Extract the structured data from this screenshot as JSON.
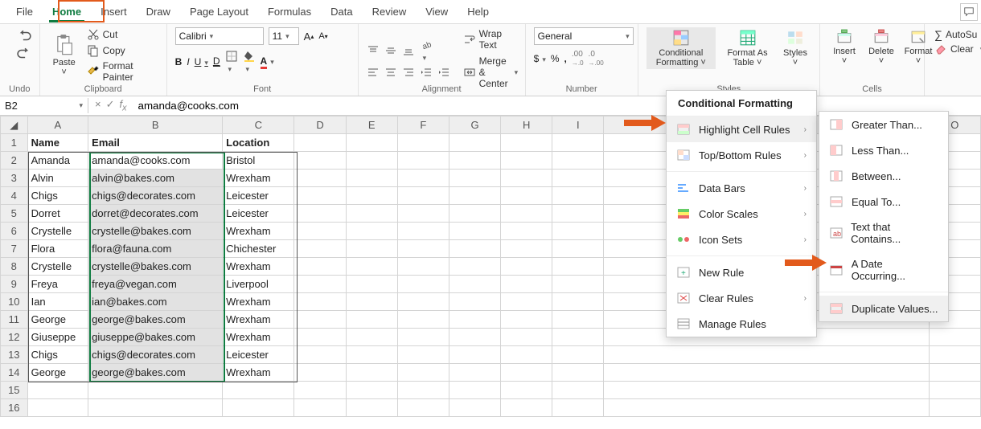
{
  "tabs": [
    "File",
    "Home",
    "Insert",
    "Draw",
    "Page Layout",
    "Formulas",
    "Data",
    "Review",
    "View",
    "Help"
  ],
  "active_tab_index": 1,
  "ribbon": {
    "undo_label": "Undo",
    "paste": "Paste",
    "cut": "Cut",
    "copy": "Copy",
    "format_painter": "Format Painter",
    "clipboard_label": "Clipboard",
    "font_name": "Calibri",
    "font_size": "11",
    "font_label": "Font",
    "wrap": "Wrap Text",
    "merge": "Merge & Center",
    "alignment_label": "Alignment",
    "number_format": "General",
    "number_label": "Number",
    "cond_format": "Conditional Formatting",
    "format_as_table": "Format As Table",
    "styles": "Styles",
    "styles_label": "Styles",
    "insert": "Insert",
    "delete": "Delete",
    "format": "Format",
    "cells_label": "Cells",
    "autosum": "AutoSu",
    "clear": "Clear"
  },
  "formula_bar": {
    "name_box": "B2",
    "formula": "amanda@cooks.com"
  },
  "columns": [
    "A",
    "B",
    "C",
    "D",
    "E",
    "F",
    "G",
    "H",
    "I",
    "O"
  ],
  "headers": {
    "A": "Name",
    "B": "Email",
    "C": "Location"
  },
  "rows": [
    {
      "n": "2",
      "A": "Amanda",
      "B": "amanda@cooks.com",
      "C": "Bristol"
    },
    {
      "n": "3",
      "A": "Alvin",
      "B": "alvin@bakes.com",
      "C": "Wrexham"
    },
    {
      "n": "4",
      "A": "Chigs",
      "B": "chigs@decorates.com",
      "C": "Leicester"
    },
    {
      "n": "5",
      "A": "Dorret",
      "B": "dorret@decorates.com",
      "C": "Leicester"
    },
    {
      "n": "6",
      "A": "Crystelle",
      "B": "crystelle@bakes.com",
      "C": "Wrexham"
    },
    {
      "n": "7",
      "A": "Flora",
      "B": "flora@fauna.com",
      "C": "Chichester"
    },
    {
      "n": "8",
      "A": "Crystelle",
      "B": "crystelle@bakes.com",
      "C": "Wrexham"
    },
    {
      "n": "9",
      "A": "Freya",
      "B": "freya@vegan.com",
      "C": "Liverpool"
    },
    {
      "n": "10",
      "A": "Ian",
      "B": "ian@bakes.com",
      "C": "Wrexham"
    },
    {
      "n": "11",
      "A": "George",
      "B": "george@bakes.com",
      "C": "Wrexham"
    },
    {
      "n": "12",
      "A": "Giuseppe",
      "B": "giuseppe@bakes.com",
      "C": "Wrexham"
    },
    {
      "n": "13",
      "A": "Chigs",
      "B": "chigs@decorates.com",
      "C": "Leicester"
    },
    {
      "n": "14",
      "A": "George",
      "B": "george@bakes.com",
      "C": "Wrexham"
    }
  ],
  "empty_rows": [
    "15",
    "16"
  ],
  "cf_menu": {
    "title": "Conditional Formatting",
    "items": [
      "Highlight Cell Rules",
      "Top/Bottom Rules",
      "Data Bars",
      "Color Scales",
      "Icon Sets",
      "New Rule",
      "Clear Rules",
      "Manage Rules"
    ]
  },
  "cf_submenu": [
    "Greater Than...",
    "Less Than...",
    "Between...",
    "Equal To...",
    "Text that Contains...",
    "A Date Occurring...",
    "Duplicate Values..."
  ]
}
